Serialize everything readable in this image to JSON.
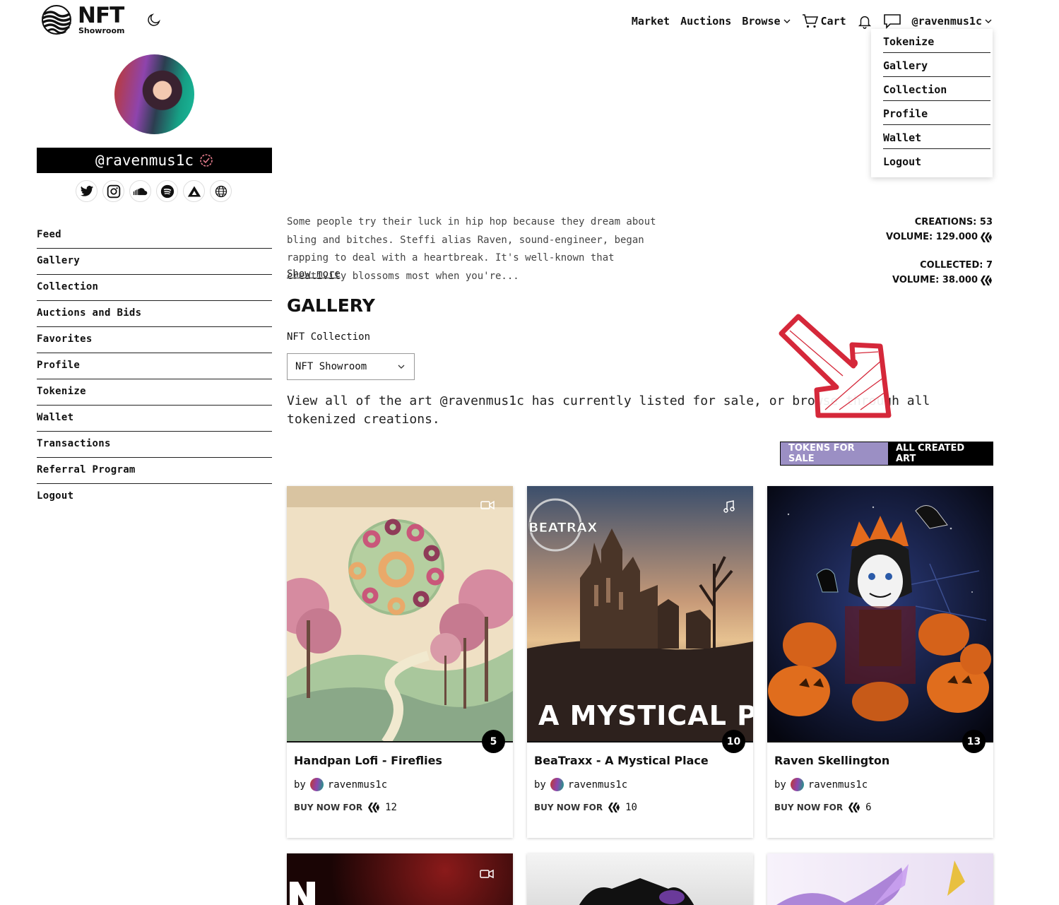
{
  "header": {
    "logo_main": "NFT",
    "logo_sub": "Showroom",
    "nav": {
      "market": "Market",
      "auctions": "Auctions",
      "browse": "Browse",
      "cart": "Cart",
      "user": "@ravenmus1c"
    }
  },
  "user_menu": [
    "Tokenize",
    "Gallery",
    "Collection",
    "Profile",
    "Wallet",
    "Logout"
  ],
  "profile": {
    "username": "@ravenmus1c",
    "socials": [
      "twitter-icon",
      "instagram-icon",
      "soundcloud-icon",
      "spotify-icon",
      "linktree-icon",
      "globe-icon"
    ]
  },
  "sidebar": {
    "items": [
      "Feed",
      "Gallery",
      "Collection",
      "Auctions and Bids",
      "Favorites",
      "Profile",
      "Tokenize",
      "Wallet",
      "Transactions",
      "Referral Program",
      "Logout"
    ]
  },
  "bio": {
    "text": "Some people try their luck in hip hop because they dream about bling and bitches. Steffi alias Raven, sound-engineer, began rapping to deal with a heartbreak. It's well-known that creativity blossoms most when you're...",
    "show_more": "Show more"
  },
  "stats": {
    "creations": "CREATIONS: 53",
    "volume_created": "VOLUME: 129.000",
    "collected": "COLLECTED: 7",
    "volume_collected": "VOLUME: 38.000"
  },
  "gallery": {
    "title": "GALLERY",
    "collection_label": "NFT Collection",
    "collection_value": "NFT Showroom",
    "description": "View all of the art @ravenmus1c has currently listed for sale, or browse through all tokenized creations.",
    "tab_sale": "TOKENS FOR SALE",
    "tab_all": "ALL CREATED ART"
  },
  "cards": [
    {
      "title": "Handpan Lofi - Fireflies",
      "by": "by",
      "author": "ravenmus1c",
      "price_label": "BUY NOW FOR",
      "price": "12",
      "count": "5",
      "media": "video-icon"
    },
    {
      "title": "BeaTraxx - A Mystical Place",
      "by": "by",
      "author": "ravenmus1c",
      "price_label": "BUY NOW FOR",
      "price": "10",
      "count": "10",
      "media": "music-icon",
      "art_text": "A MYSTICAL PLACE",
      "watermark": "BEATRAX"
    },
    {
      "title": "Raven Skellington",
      "by": "by",
      "author": "ravenmus1c",
      "price_label": "BUY NOW FOR",
      "price": "6",
      "count": "13",
      "media": "none"
    }
  ]
}
